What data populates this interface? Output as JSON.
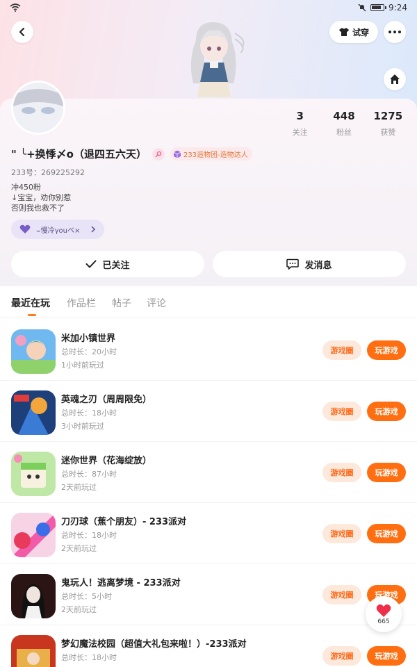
{
  "status_bar": {
    "time": "9:24"
  },
  "header": {
    "try_on_label": "试穿"
  },
  "profile": {
    "stats": [
      {
        "value": "3",
        "label": "关注"
      },
      {
        "value": "448",
        "label": "粉丝"
      },
      {
        "value": "1275",
        "label": "获赞"
      }
    ],
    "username": "\" ╰+换悸〆o（退四五六天）",
    "badge": "233造物团-造物达人",
    "id_text": "233号：269225292",
    "bio": [
      "冲450粉",
      "↓宝宝，劝你别惹",
      "否则我也救不了"
    ],
    "relation_pill": "⌣慢冷γouベ×"
  },
  "actions": {
    "followed_label": "已关注",
    "message_label": "发消息"
  },
  "tabs": [
    "最近在玩",
    "作品栏",
    "帖子",
    "评论"
  ],
  "games": [
    {
      "name": "米加小镇世界",
      "duration": "总时长：20小时",
      "last_played": "1小时前玩过"
    },
    {
      "name": "英魂之刃（周周限免）",
      "duration": "总时长：18小时",
      "last_played": "3小时前玩过"
    },
    {
      "name": "迷你世界（花海绽放）",
      "duration": "总时长：87小时",
      "last_played": "2天前玩过"
    },
    {
      "name": "刀刃球（蕉个朋友）- 233派对",
      "duration": "总时长：18小时",
      "last_played": "2天前玩过"
    },
    {
      "name": "鬼玩人！逃离梦境 - 233派对",
      "duration": "总时长：5小时",
      "last_played": "2天前玩过"
    },
    {
      "name": "梦幻魔法校园（超值大礼包来啦！）-233派对",
      "duration": "总时长：18小时",
      "last_played": ""
    }
  ],
  "game_buttons": {
    "circle_label": "游戏圈",
    "play_label": "玩游戏"
  },
  "floating_like": {
    "count": "665"
  },
  "colors": {
    "accent": "#ff6f12",
    "accent_light": "#fde8dc"
  }
}
